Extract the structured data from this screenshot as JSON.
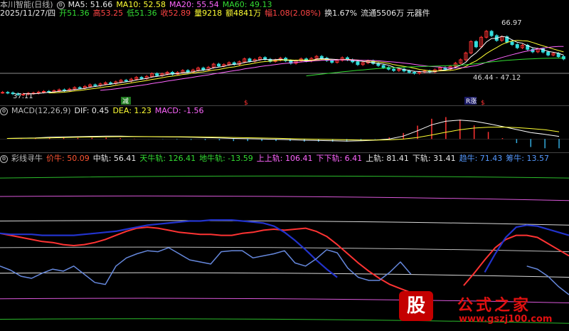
{
  "app": {
    "title": "本川智能(日线)"
  },
  "header1": {
    "ma5_label": "MA5: 51.66",
    "ma10_label": "MA10: 52.58",
    "ma20_label": "MA20: 55.54",
    "ma60_label": "MA60: 49.13",
    "date": "2025/11/27/四",
    "open": "开51.36",
    "high": "高53.25",
    "low": "低51.36",
    "close": "收52.89",
    "volume": "量9218",
    "amount": "额4841万",
    "change": "幅1.08(2.08%)",
    "turnover": "换1.67%",
    "float": "流通5506万 元器件"
  },
  "header2": {
    "title": "MACD(12,26,9)",
    "dif": "DIF: 0.45",
    "dea": "DEA: 1.23",
    "macd": "MACD: -1.56"
  },
  "header3": {
    "title": "彩线寻牛",
    "price": "价牛: 50.09",
    "mid": "中轨: 56.41",
    "sky": "天牛轨: 126.41",
    "ground": "地牛轨: -13.59",
    "upup": "上上轨: 106.41",
    "downdown": "下下轨: 6.41",
    "up": "上轨: 81.41",
    "down": "下轨: 31.41",
    "bull": "趋牛: 71.43",
    "chip": "筹牛: 13.57"
  },
  "annotations": {
    "high_mark": "66.97",
    "low_mark": "37.11",
    "range_mark": "46.44 - 47.12",
    "tag_reduce": "减",
    "tag_s1": "$",
    "tag_increase": "R涨",
    "tag_s2": "$"
  },
  "watermark": {
    "logo": "股",
    "title": "公式之家",
    "url": "www.gszj100.com"
  },
  "colors": {
    "up": "#ff3333",
    "down": "#33dddd",
    "ma5": "#ffffff",
    "ma10": "#ffff33",
    "ma20": "#ff66ff",
    "ma60": "#33dd33"
  },
  "chart_data": [
    {
      "type": "candlestick",
      "title": "本川智能(日线)",
      "ylim": [
        35,
        70
      ],
      "close": [
        38.2,
        38.0,
        37.6,
        37.2,
        37.4,
        37.8,
        37.9,
        38.3,
        38.6,
        38.4,
        38.9,
        39.3,
        39.0,
        39.6,
        40.3,
        40.1,
        40.8,
        41.5,
        41.2,
        41.9,
        42.4,
        42.1,
        42.8,
        43.5,
        43.2,
        44.0,
        44.8,
        44.3,
        45.2,
        46.4,
        45.6,
        46.3,
        47.0,
        46.2,
        46.9,
        47.8,
        47.1,
        48.0,
        48.9,
        48.1,
        49.2,
        50.6,
        49.8,
        50.4,
        51.2,
        50.5,
        51.6,
        52.9,
        51.9,
        52.6,
        53.5,
        52.7,
        51.8,
        52.4,
        53.2,
        52.1,
        51.0,
        52.0,
        52.9,
        52.0,
        53.1,
        54.0,
        53.2,
        52.2,
        51.4,
        52.3,
        53.4,
        52.5,
        51.6,
        50.4,
        51.2,
        52.0,
        50.9,
        50.0,
        49.1,
        48.4,
        47.8,
        48.4,
        47.6,
        47.0,
        46.6,
        47.1,
        47.6,
        47.2,
        48.1,
        49.0,
        48.4,
        49.6,
        51.0,
        52.5,
        55.5,
        60.5,
        58.2,
        62.4,
        65.0,
        63.1,
        61.0,
        62.6,
        60.3,
        59.2,
        57.8,
        58.9,
        57.1,
        56.0,
        57.3,
        55.9,
        54.6,
        55.3,
        53.9,
        52.9
      ],
      "ma_series": [
        {
          "name": "MA5"
        },
        {
          "name": "MA10"
        },
        {
          "name": "MA20"
        },
        {
          "name": "MA60"
        }
      ]
    },
    {
      "type": "line",
      "title": "MACD(12,26,9)",
      "series": [
        {
          "name": "DIF",
          "values": [
            0.1,
            0.15,
            0.2,
            0.3,
            0.35,
            0.4,
            0.45,
            0.5,
            0.48,
            0.44,
            0.4,
            0.38,
            0.35,
            0.3,
            0.25,
            0.2,
            0.1,
            0.05,
            0.0,
            -0.05,
            -0.1,
            -0.2,
            -0.25,
            -0.3,
            -0.35,
            -0.3,
            -0.2,
            0.0,
            0.5,
            1.4,
            2.4,
            3.0,
            3.2,
            3.0,
            2.6,
            2.1,
            1.6,
            1.1,
            0.8,
            0.45
          ]
        },
        {
          "name": "DEA",
          "values": [
            0.1,
            0.12,
            0.15,
            0.2,
            0.25,
            0.3,
            0.34,
            0.38,
            0.4,
            0.41,
            0.41,
            0.4,
            0.39,
            0.37,
            0.34,
            0.31,
            0.27,
            0.22,
            0.17,
            0.12,
            0.07,
            0.02,
            -0.03,
            -0.08,
            -0.13,
            -0.16,
            -0.17,
            -0.14,
            -0.01,
            0.27,
            0.69,
            1.15,
            1.56,
            1.85,
            2.0,
            2.02,
            1.94,
            1.77,
            1.58,
            1.23
          ]
        }
      ],
      "ylim": [
        -2,
        4
      ]
    },
    {
      "type": "line",
      "title": "彩线寻牛",
      "ylim": [
        -20,
        140
      ],
      "bands": [
        {
          "name": "天牛轨",
          "color": "#33dd33",
          "start": 126,
          "end": 126
        },
        {
          "name": "上上轨",
          "color": "#ff66ff",
          "start": 108,
          "end": 104
        },
        {
          "name": "上轨",
          "color": "#ffffff",
          "start": 84,
          "end": 80
        },
        {
          "name": "中轨",
          "color": "#dddddd",
          "start": 58,
          "end": 54
        },
        {
          "name": "下轨",
          "color": "#ffffff",
          "start": 33,
          "end": 29
        },
        {
          "name": "下下轨",
          "color": "#ff66ff",
          "start": 8,
          "end": 4
        },
        {
          "name": "地牛轨",
          "color": "#33dd33",
          "start": -12,
          "end": -16
        }
      ],
      "series": [
        {
          "name": "价牛",
          "color": "#ff3333",
          "values": [
            72,
            70,
            68,
            66,
            64,
            63,
            61,
            60,
            61,
            63,
            66,
            70,
            74,
            77,
            78,
            77,
            75,
            73,
            72,
            71,
            71,
            70,
            70,
            72,
            73,
            75,
            76,
            75,
            76,
            77,
            74,
            69,
            61,
            52,
            43,
            35,
            28,
            22,
            18,
            14,
            null,
            null,
            null,
            null,
            21,
            33,
            46,
            58,
            66,
            70,
            70,
            68,
            62,
            56,
            50
          ]
        },
        {
          "name": "趋牛",
          "color": "#2233cc",
          "values": [
            72,
            71,
            71,
            71,
            70,
            70,
            70,
            70,
            71,
            72,
            73,
            74,
            76,
            78,
            80,
            81,
            82,
            83,
            84,
            84,
            85,
            85,
            85,
            84,
            83,
            82,
            79,
            73,
            65,
            56,
            46,
            37,
            29,
            null,
            null,
            null,
            null,
            null,
            null,
            null,
            null,
            null,
            null,
            null,
            null,
            null,
            34,
            52,
            68,
            78,
            80,
            79,
            76,
            73,
            70
          ]
        },
        {
          "name": "筹牛",
          "color": "#6688dd",
          "values": [
            40,
            36,
            30,
            28,
            33,
            37,
            35,
            40,
            32,
            24,
            22,
            40,
            48,
            52,
            55,
            54,
            58,
            52,
            46,
            44,
            42,
            54,
            55,
            55,
            48,
            50,
            52,
            55,
            43,
            40,
            47,
            56,
            53,
            38,
            29,
            26,
            26,
            34,
            44,
            32,
            null,
            null,
            null,
            null,
            null,
            null,
            null,
            null,
            null,
            null,
            40,
            37,
            30,
            20,
            12
          ]
        }
      ]
    }
  ]
}
